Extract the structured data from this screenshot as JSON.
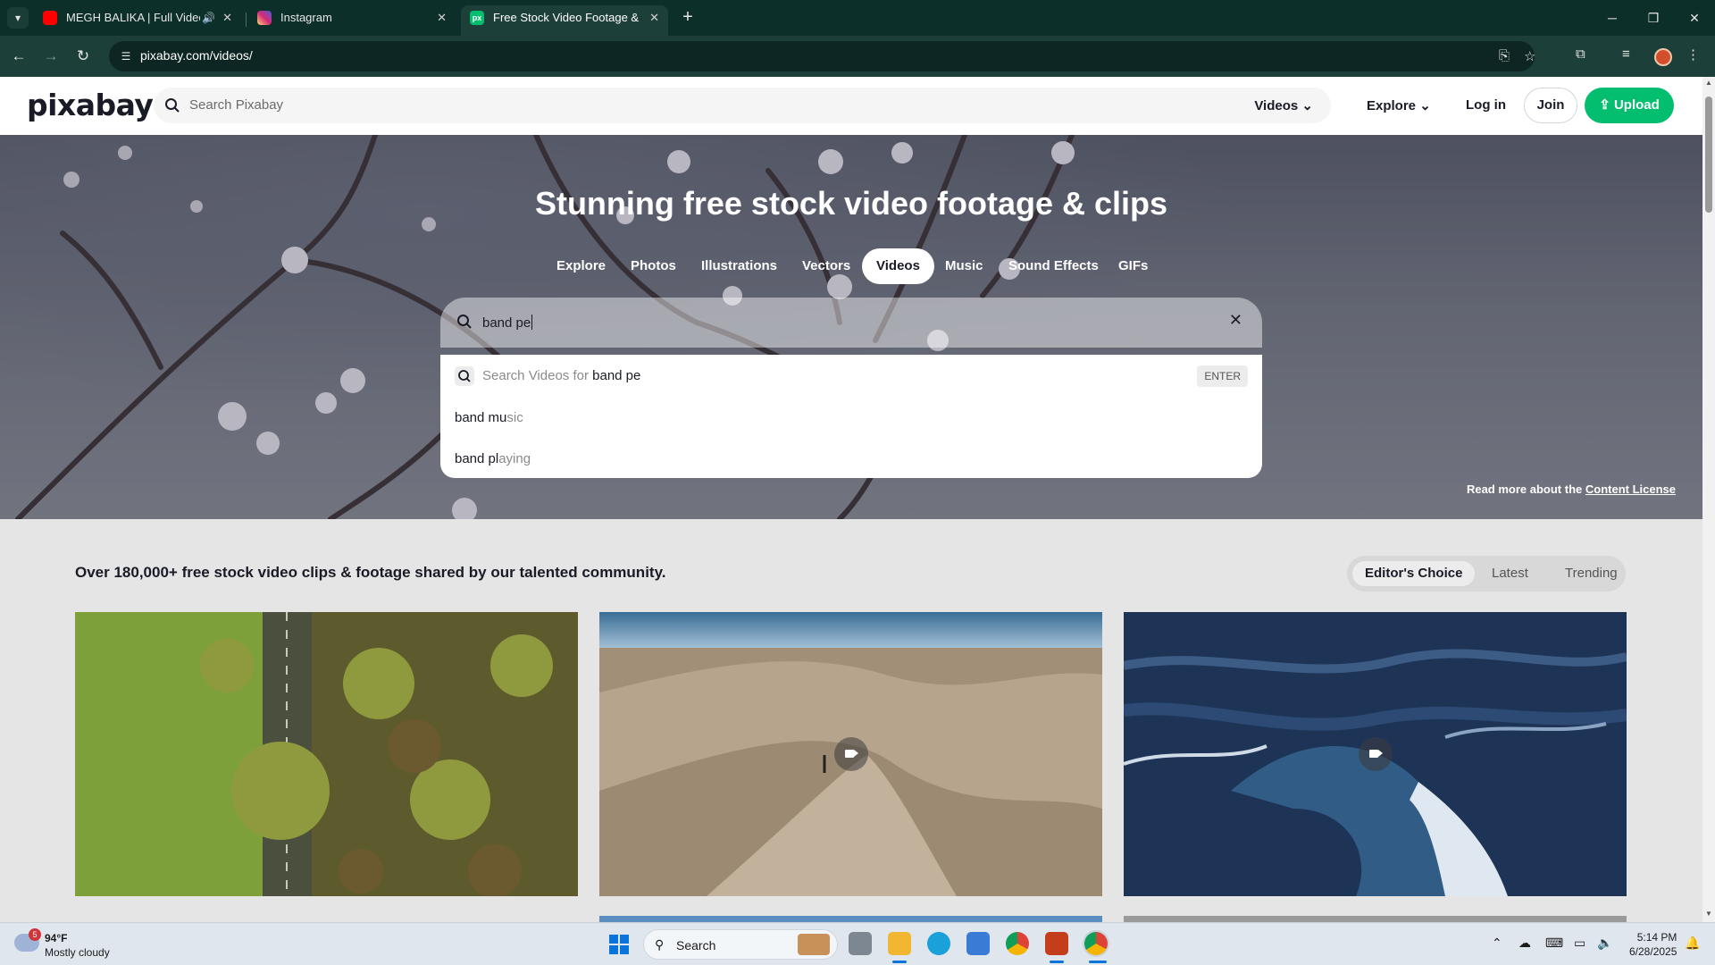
{
  "browser": {
    "tabs": [
      {
        "title": "MEGH BALIKA | Full Video S",
        "favicon_color": "#ff0000",
        "audio": "🔊"
      },
      {
        "title": "Instagram",
        "favicon_color": "#d62976"
      },
      {
        "title": "Free Stock Video Footage & Vi",
        "favicon_color": "#02be6e",
        "favicon_text": "px",
        "active": true
      }
    ],
    "close_glyph": "✕",
    "new_tab_glyph": "+",
    "url": "pixabay.com/videos/",
    "window_controls": {
      "minimize": "─",
      "maximize": "❐",
      "close": "✕"
    }
  },
  "header": {
    "logo": "pixabay",
    "search_placeholder": "Search Pixabay",
    "search_filter": "Videos",
    "explore": "Explore",
    "login": "Log in",
    "join": "Join",
    "upload": "Upload",
    "accent_color": "#02be6e"
  },
  "hero": {
    "title": "Stunning free stock video footage & clips",
    "categories": [
      "Explore",
      "Photos",
      "Illustrations",
      "Vectors",
      "Videos",
      "Music",
      "Sound Effects",
      "GIFs"
    ],
    "active_category": "Videos",
    "search_value": "band pe",
    "suggestions": {
      "search_prefix": "Search Videos for ",
      "query": "band pe",
      "enter_hint": "ENTER",
      "items": [
        {
          "typed": "band mu",
          "rest": "sic"
        },
        {
          "typed": "band pl",
          "rest": "aying"
        }
      ]
    },
    "license_prefix": "Read more about the ",
    "license_link": "Content License"
  },
  "content": {
    "intro": "Over 180,000+ free stock video clips & footage shared by our talented community.",
    "sort_options": [
      "Editor's Choice",
      "Latest",
      "Trending"
    ],
    "active_sort": "Editor's Choice",
    "thumbnails": [
      {
        "subject": "aerial road between fields and trees",
        "video_icon": false
      },
      {
        "subject": "person on desert sand dunes",
        "video_icon": true
      },
      {
        "subject": "ocean waves",
        "video_icon": true
      }
    ]
  },
  "taskbar": {
    "weather_temp": "94°F",
    "weather_condition": "Mostly cloudy",
    "weather_badge": "5",
    "search_label": "Search",
    "time": "5:14 PM",
    "date": "6/28/2025"
  }
}
